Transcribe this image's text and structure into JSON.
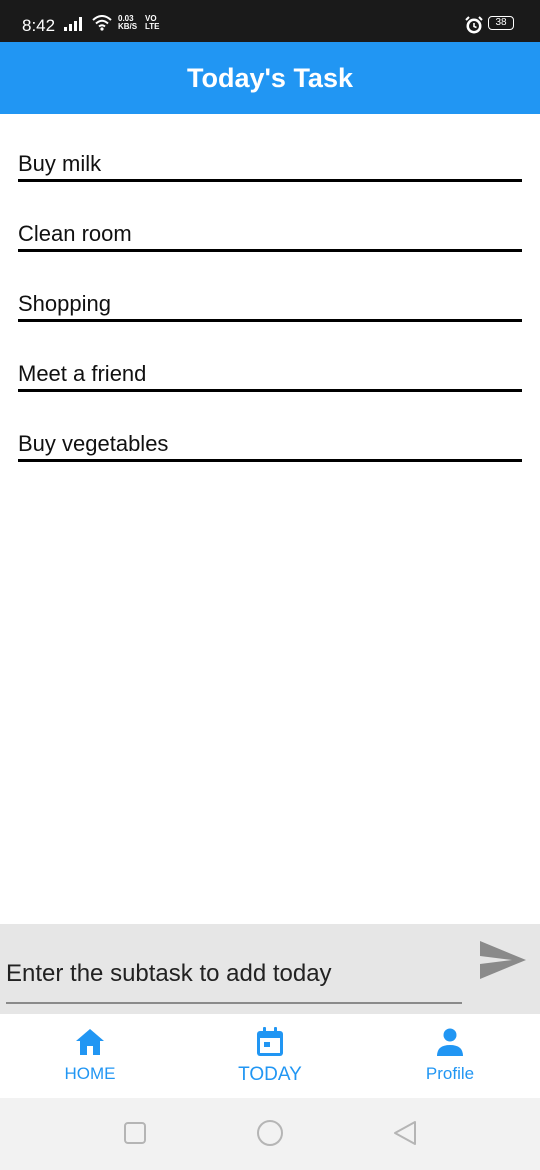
{
  "status_bar": {
    "time": "8:42",
    "net_speed_value": "0.03",
    "net_speed_unit": "KB/S",
    "volte_top": "VO",
    "volte_bottom": "LTE",
    "battery": "38",
    "icons": [
      "signal-icon",
      "wifi-icon",
      "alarm-icon",
      "battery-icon"
    ]
  },
  "app_bar": {
    "title": "Today's Task",
    "color": "#2196f3"
  },
  "tasks": [
    {
      "label": "Buy milk"
    },
    {
      "label": "Clean room"
    },
    {
      "label": "Shopping"
    },
    {
      "label": "Meet a friend"
    },
    {
      "label": "Buy vegetables"
    }
  ],
  "input": {
    "placeholder": "Enter the subtask to add today",
    "value": ""
  },
  "send_icon": "send-icon",
  "bottom_nav": {
    "items": [
      {
        "label": "HOME",
        "icon": "home-icon"
      },
      {
        "label": "TODAY",
        "icon": "calendar-icon",
        "active": true
      },
      {
        "label": "Profile",
        "icon": "person-icon"
      }
    ],
    "accent": "#2196f3"
  },
  "system_nav": {
    "icons": [
      "recents-icon",
      "home-circle-icon",
      "back-icon"
    ]
  }
}
